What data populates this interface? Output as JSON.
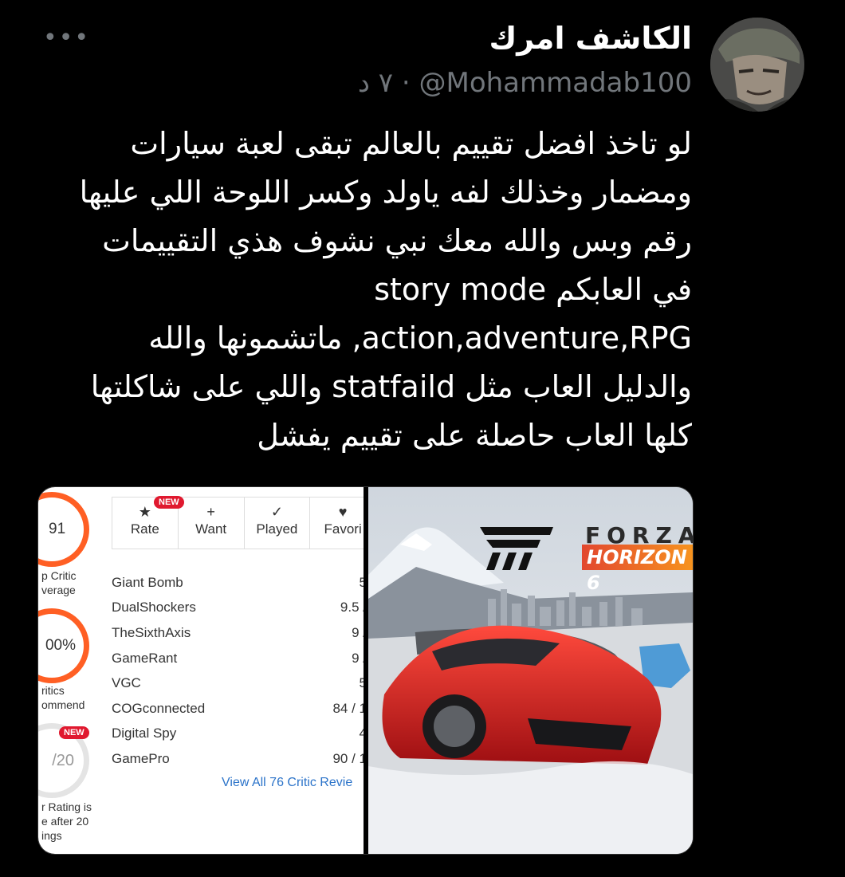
{
  "tweet": {
    "display_name": "الكاشف امرك",
    "handle": "@Mohammadab100",
    "meta_separator": "·",
    "timestamp": "٧ د",
    "more_icon": "more-horizontal-icon",
    "text": "لو تاخذ افضل تقييم بالعالم تبقى لعبة سيارات ومضمار وخذلك لفه ياولد وكسر اللوحة اللي عليها رقم وبس والله معك نبي نشوف هذي التقييمات في العابكم story mode action,adventure,RPG, ماتشمونها والله والدليل العاب مثل statfaild واللي على شاكلتها كلها العاب حاصلة على تقييم يفشل"
  },
  "review_screenshot": {
    "metascore": "91",
    "metascore_label": "p Critic\nverage",
    "recommend_pct": "00%",
    "recommend_label": "ritics\nommend",
    "user_new_badge": "NEW",
    "user_score": "/20",
    "user_label": "r Rating is\ne after 20\nings",
    "actions": [
      {
        "label": "Rate",
        "icon": "star-icon",
        "badge": "NEW"
      },
      {
        "label": "Want",
        "icon": "plus-icon"
      },
      {
        "label": "Played",
        "icon": "checkmark-icon"
      },
      {
        "label": "Favori",
        "icon": "heart-icon"
      }
    ],
    "critics": [
      {
        "name": "Giant Bomb",
        "score": "5"
      },
      {
        "name": "DualShockers",
        "score": "9.5 /"
      },
      {
        "name": "TheSixthAxis",
        "score": "9 /"
      },
      {
        "name": "GameRant",
        "score": "9 /"
      },
      {
        "name": "VGC",
        "score": "5"
      },
      {
        "name": "COGconnected",
        "score": "84 / 1"
      },
      {
        "name": "Digital Spy",
        "score": "4"
      },
      {
        "name": "GamePro",
        "score": "90 / 1"
      }
    ],
    "view_all": "View All 76 Critic Revie"
  },
  "cover": {
    "title_top": "FORZA",
    "title_bottom": "HORIZON 6"
  },
  "colors": {
    "background": "#000000",
    "text": "#e7e9ea",
    "muted": "#71767b",
    "score_ring": "#ff5f24",
    "new_badge": "#e0192f",
    "link": "#2b73c9"
  }
}
